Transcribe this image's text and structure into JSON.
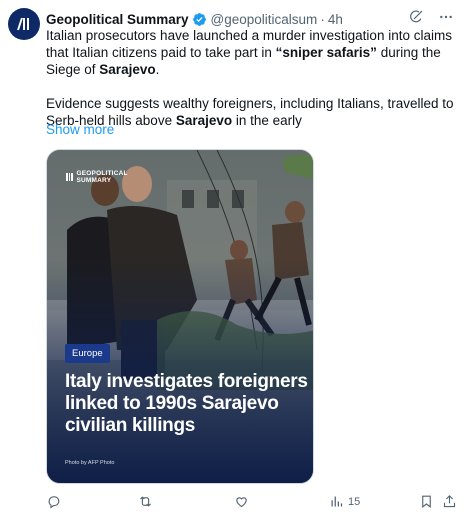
{
  "account": {
    "avatar_text": "/III",
    "name": "Geopolitical Summary",
    "handle": "@geopoliticalsum",
    "separator": "·",
    "time": "4h"
  },
  "tweet": {
    "para1_a": "Italian prosecutors have launched a murder investigation into claims that Italian citizens paid to take part in ",
    "para1_b": "“sniper safaris”",
    "para1_c": " during the Siege of ",
    "para1_d": "Sarajevo",
    "para1_e": ".",
    "para2_a": "Evidence suggests wealthy foreigners, including Italians, travelled to Serb-held hills above ",
    "para2_b": "Sarajevo",
    "para2_c": " in the early",
    "show_more": "Show more"
  },
  "media": {
    "logo_line1": "GEOPOLITICAL",
    "logo_line2": "SUMMARY",
    "badge": "Europe",
    "headline": "Italy investigates foreigners linked to 1990s Sarajevo civilian killings",
    "credit": "Photo by AFP Photo"
  },
  "actions": {
    "reply_count": "",
    "repost_count": "",
    "like_count": "",
    "views_count": "15"
  },
  "colors": {
    "accent": "#1d9bf0",
    "muted": "#536471",
    "badge": "#1b3a8c",
    "avatar": "#0e2a66"
  },
  "icons": [
    "verified-icon",
    "grok-icon",
    "more-icon",
    "reply-icon",
    "repost-icon",
    "like-icon",
    "views-icon",
    "bookmark-icon",
    "share-icon"
  ]
}
